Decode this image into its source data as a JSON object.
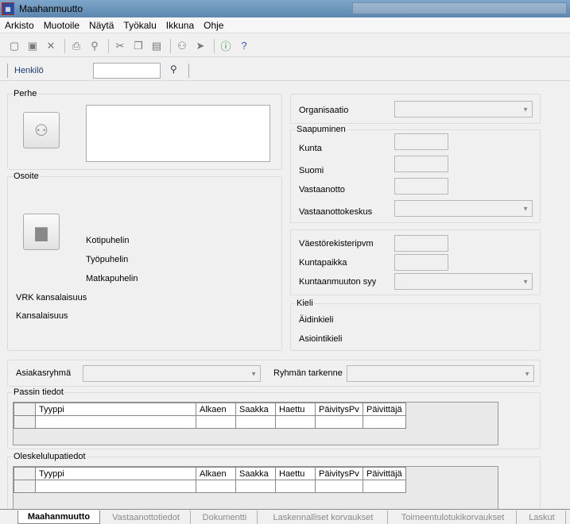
{
  "window": {
    "title": "Maahanmuutto"
  },
  "menu": [
    "Arkisto",
    "Muotoile",
    "Näytä",
    "Työkalu",
    "Ikkuna",
    "Ohje"
  ],
  "filter": {
    "label": "Henkilö",
    "value": ""
  },
  "perhe": {
    "label": "Perhe"
  },
  "osoite": {
    "label": "Osoite",
    "kotipuhelin": "Kotipuhelin",
    "tyopuhelin": "Työpuhelin",
    "matkapuhelin": "Matkapuhelin",
    "vrk_kansalaisuus": "VRK kansalaisuus",
    "kansalaisuus": "Kansalaisuus"
  },
  "right": {
    "organisaatio": "Organisaatio",
    "saapuminen": "Saapuminen",
    "kunta": "Kunta",
    "suomi": "Suomi",
    "vastaanotto": "Vastaanotto",
    "vastaanottokeskus": "Vastaanottokeskus",
    "vaestorekisteripvm": "Väestörekisteripvm",
    "kuntapaikka": "Kuntapaikka",
    "kuntaanmuuton_syy": "Kuntaanmuuton syy",
    "kieli": "Kieli",
    "aidinkieli": "Äidinkieli",
    "asiointikieli": "Asiointikieli"
  },
  "asiakasryhma": {
    "label": "Asiakasryhmä",
    "tarkenne_label": "Ryhmän tarkenne"
  },
  "passi": {
    "label": "Passin tiedot",
    "columns": [
      "Tyyppi",
      "Alkaen",
      "Saakka",
      "Haettu",
      "PäivitysPv",
      "Päivittäjä"
    ]
  },
  "oleskelu": {
    "label": "Oleskelulupatiedot",
    "columns": [
      "Tyyppi",
      "Alkaen",
      "Saakka",
      "Haettu",
      "PäivitysPv",
      "Päivittäjä"
    ]
  },
  "tabs": [
    "Maahanmuutto",
    "Vastaanottotiedot",
    "Dokumentti",
    "Laskennalliset korvaukset",
    "Toimeentulotukikorvaukset",
    "Laskut"
  ]
}
